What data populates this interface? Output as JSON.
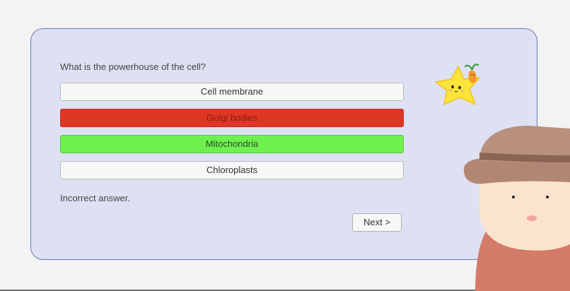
{
  "quiz": {
    "question": "What is the powerhouse of the cell?",
    "answers": [
      {
        "label": "Cell membrane",
        "state": "default"
      },
      {
        "label": "Golgi bodies",
        "state": "incorrect-selected"
      },
      {
        "label": "Mitochondria",
        "state": "correct"
      },
      {
        "label": "Chloroplasts",
        "state": "default"
      }
    ],
    "feedback": "Incorrect answer.",
    "next_label": "Next >"
  },
  "colors": {
    "panel_background": "#dee1f3",
    "panel_border": "#6a78b4",
    "incorrect": "#e03626",
    "correct": "#6ef14e"
  },
  "icons": {
    "mascot": "star-mascot-icon",
    "character": "hat-character-icon"
  }
}
